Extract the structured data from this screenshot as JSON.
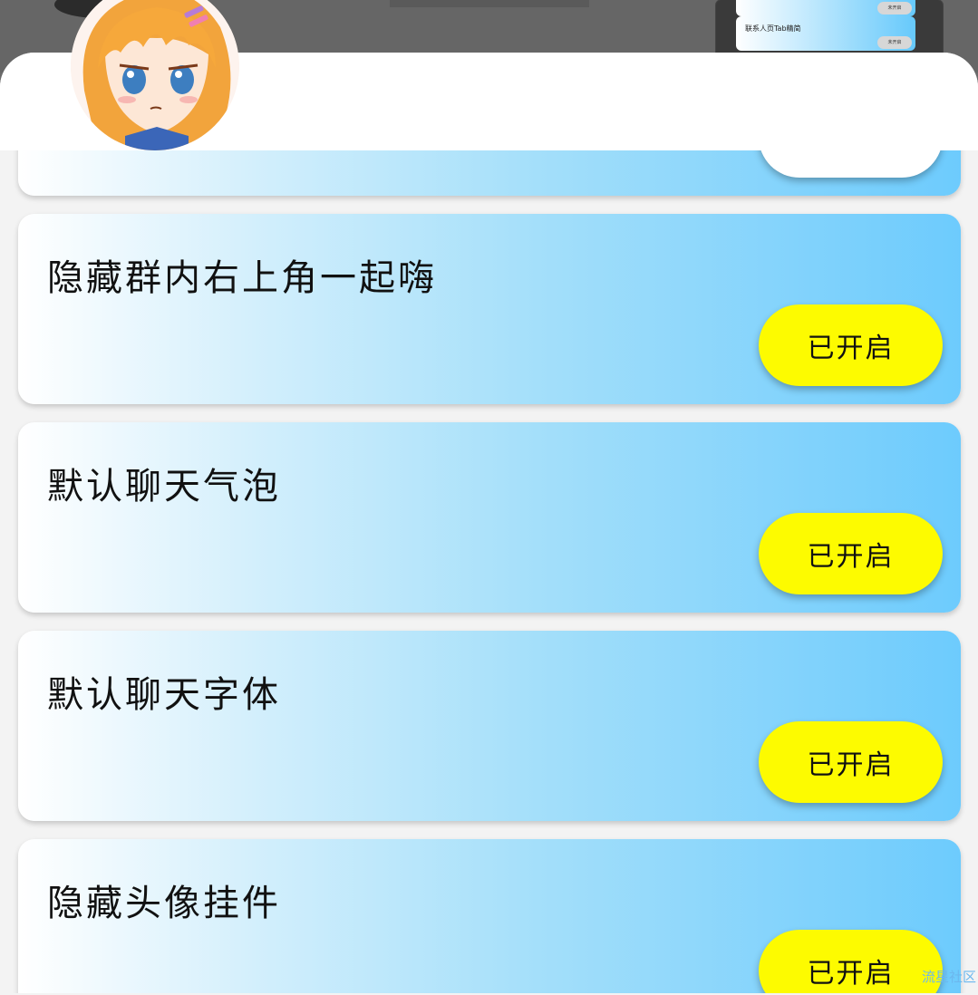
{
  "background": {
    "thumbnail_card_text": "联系人页Tab精简",
    "thumbnail_button_text": "未开启"
  },
  "avatar": {
    "icon": "anime-girl-avatar"
  },
  "cards": [
    {
      "title": "",
      "button": ""
    },
    {
      "title": "隐藏群内右上角一起嗨",
      "button": "已开启"
    },
    {
      "title": "默认聊天气泡",
      "button": "已开启"
    },
    {
      "title": "默认聊天字体",
      "button": "已开启"
    },
    {
      "title": "隐藏头像挂件",
      "button": "已开启"
    }
  ],
  "watermark": "流星社区",
  "colors": {
    "card_gradient_start": "#ffffff",
    "card_gradient_end": "#6dcbfd",
    "button_on": "#fdfb00"
  }
}
